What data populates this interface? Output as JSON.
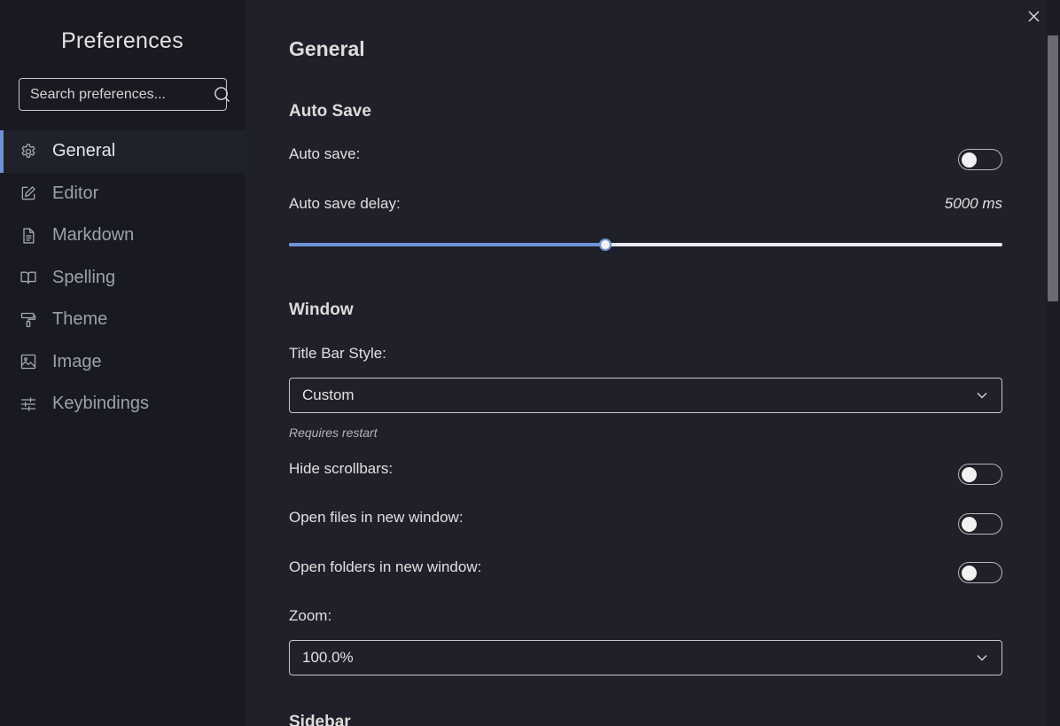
{
  "sidebar": {
    "title": "Preferences",
    "search_placeholder": "Search preferences...",
    "items": [
      {
        "label": "General",
        "icon": "gear-icon",
        "active": true
      },
      {
        "label": "Editor",
        "icon": "edit-icon",
        "active": false
      },
      {
        "label": "Markdown",
        "icon": "document-icon",
        "active": false
      },
      {
        "label": "Spelling",
        "icon": "book-icon",
        "active": false
      },
      {
        "label": "Theme",
        "icon": "paint-roller-icon",
        "active": false
      },
      {
        "label": "Image",
        "icon": "image-icon",
        "active": false
      },
      {
        "label": "Keybindings",
        "icon": "sliders-icon",
        "active": false
      }
    ]
  },
  "main": {
    "title": "General",
    "auto_save": {
      "section_title": "Auto Save",
      "auto_save_label": "Auto save:",
      "auto_save_enabled": false,
      "delay_label": "Auto save delay:",
      "delay_value": "5000 ms",
      "delay_fraction": 0.444
    },
    "window": {
      "section_title": "Window",
      "title_bar_label": "Title Bar Style:",
      "title_bar_value": "Custom",
      "title_bar_note": "Requires restart",
      "hide_scrollbars_label": "Hide scrollbars:",
      "hide_scrollbars_enabled": false,
      "open_files_label": "Open files in new window:",
      "open_files_enabled": false,
      "open_folders_label": "Open folders in new window:",
      "open_folders_enabled": false,
      "zoom_label": "Zoom:",
      "zoom_value": "100.0%"
    },
    "sidebar_section_title": "Sidebar"
  },
  "colors": {
    "accent": "#6f93d6",
    "sidebar_bg": "#191a21",
    "main_bg": "#1f2029"
  }
}
